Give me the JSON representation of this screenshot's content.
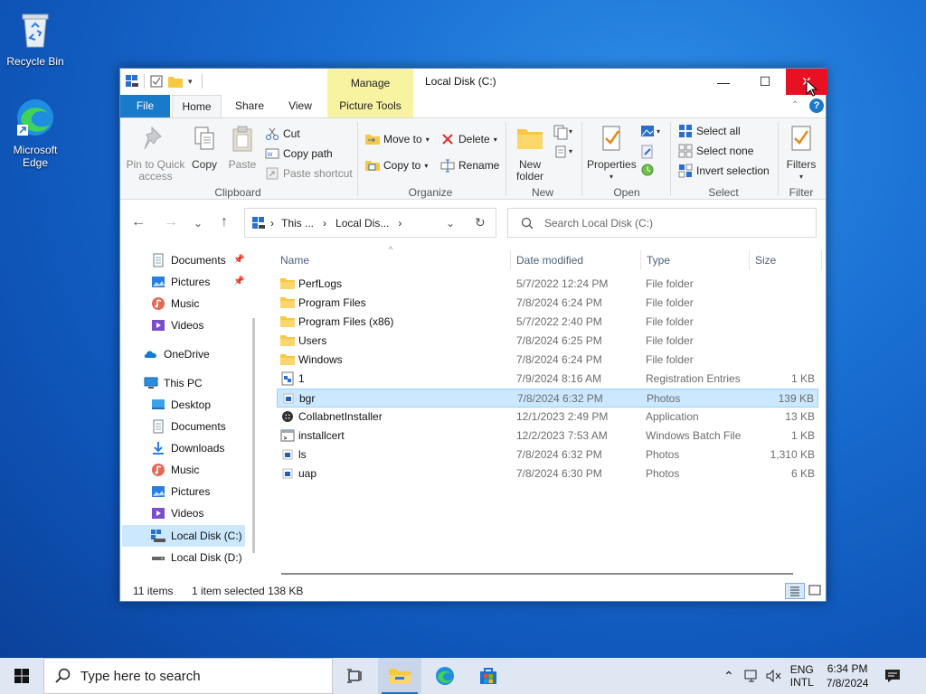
{
  "desktop": {
    "icons": [
      {
        "label": "Recycle Bin"
      },
      {
        "label": "Microsoft Edge"
      }
    ]
  },
  "window": {
    "title": "Local Disk (C:)",
    "contextual_group": "Manage",
    "tabs": [
      "File",
      "Home",
      "Share",
      "View",
      "Picture Tools"
    ],
    "controls": {
      "minimize": "—",
      "maximize": "☐",
      "close": "✕"
    }
  },
  "ribbon": {
    "clipboard": {
      "label": "Clipboard",
      "pin": "Pin to Quick access",
      "copy": "Copy",
      "paste": "Paste",
      "cut": "Cut",
      "copy_path": "Copy path",
      "paste_shortcut": "Paste shortcut"
    },
    "organize": {
      "label": "Organize",
      "move_to": "Move to",
      "copy_to": "Copy to",
      "delete": "Delete",
      "rename": "Rename"
    },
    "new": {
      "label": "New",
      "new_folder": "New folder"
    },
    "open": {
      "label": "Open",
      "properties": "Properties"
    },
    "select": {
      "label": "Select",
      "select_all": "Select all",
      "select_none": "Select none",
      "invert": "Invert selection"
    },
    "filter": {
      "label": "Filter",
      "filters": "Filters"
    }
  },
  "navbar": {
    "breadcrumb": [
      "This ...",
      "Local Dis..."
    ],
    "search_placeholder": "Search Local Disk (C:)"
  },
  "leftpane": {
    "quick": [
      {
        "label": "Documents"
      },
      {
        "label": "Pictures"
      },
      {
        "label": "Music"
      },
      {
        "label": "Videos"
      }
    ],
    "onedrive": "OneDrive",
    "thispc": "This PC",
    "pc_items": [
      {
        "label": "Desktop"
      },
      {
        "label": "Documents"
      },
      {
        "label": "Downloads"
      },
      {
        "label": "Music"
      },
      {
        "label": "Pictures"
      },
      {
        "label": "Videos"
      },
      {
        "label": "Local Disk (C:)"
      },
      {
        "label": "Local Disk (D:)"
      }
    ]
  },
  "filelist": {
    "columns": {
      "name": "Name",
      "date": "Date modified",
      "type": "Type",
      "size": "Size"
    },
    "rows": [
      {
        "name": "PerfLogs",
        "date": "5/7/2022 12:24 PM",
        "type": "File folder",
        "size": "",
        "icon": "folder-icon"
      },
      {
        "name": "Program Files",
        "date": "7/8/2024 6:24 PM",
        "type": "File folder",
        "size": "",
        "icon": "folder-icon"
      },
      {
        "name": "Program Files (x86)",
        "date": "5/7/2022 2:40 PM",
        "type": "File folder",
        "size": "",
        "icon": "folder-icon"
      },
      {
        "name": "Users",
        "date": "7/8/2024 6:25 PM",
        "type": "File folder",
        "size": "",
        "icon": "folder-icon"
      },
      {
        "name": "Windows",
        "date": "7/8/2024 6:24 PM",
        "type": "File folder",
        "size": "",
        "icon": "folder-icon"
      },
      {
        "name": "1",
        "date": "7/9/2024 8:16 AM",
        "type": "Registration Entries",
        "size": "1 KB",
        "icon": "registry-file-icon"
      },
      {
        "name": "bgr",
        "date": "7/8/2024 6:32 PM",
        "type": "Photos",
        "size": "139 KB",
        "icon": "image-file-icon"
      },
      {
        "name": "CollabnetInstaller",
        "date": "12/1/2023 2:49 PM",
        "type": "Application",
        "size": "13 KB",
        "icon": "application-icon"
      },
      {
        "name": "installcert",
        "date": "12/2/2023 7:53 AM",
        "type": "Windows Batch File",
        "size": "1 KB",
        "icon": "batch-file-icon"
      },
      {
        "name": "ls",
        "date": "7/8/2024 6:32 PM",
        "type": "Photos",
        "size": "1,310 KB",
        "icon": "image-file-icon"
      },
      {
        "name": "uap",
        "date": "7/8/2024 6:30 PM",
        "type": "Photos",
        "size": "6 KB",
        "icon": "image-file-icon"
      }
    ],
    "selected_index": 6
  },
  "status": {
    "items": "11 items",
    "selected": "1 item selected",
    "size": "138 KB"
  },
  "taskbar": {
    "search_placeholder": "Type here to search",
    "lang1": "ENG",
    "lang2": "INTL",
    "time": "6:34 PM",
    "date": "7/8/2024"
  },
  "colors": {
    "accent": "#1979ca",
    "selection": "#cce8ff",
    "close": "#e81123",
    "manage": "#f7f3a0",
    "folder": "#f8c842"
  }
}
